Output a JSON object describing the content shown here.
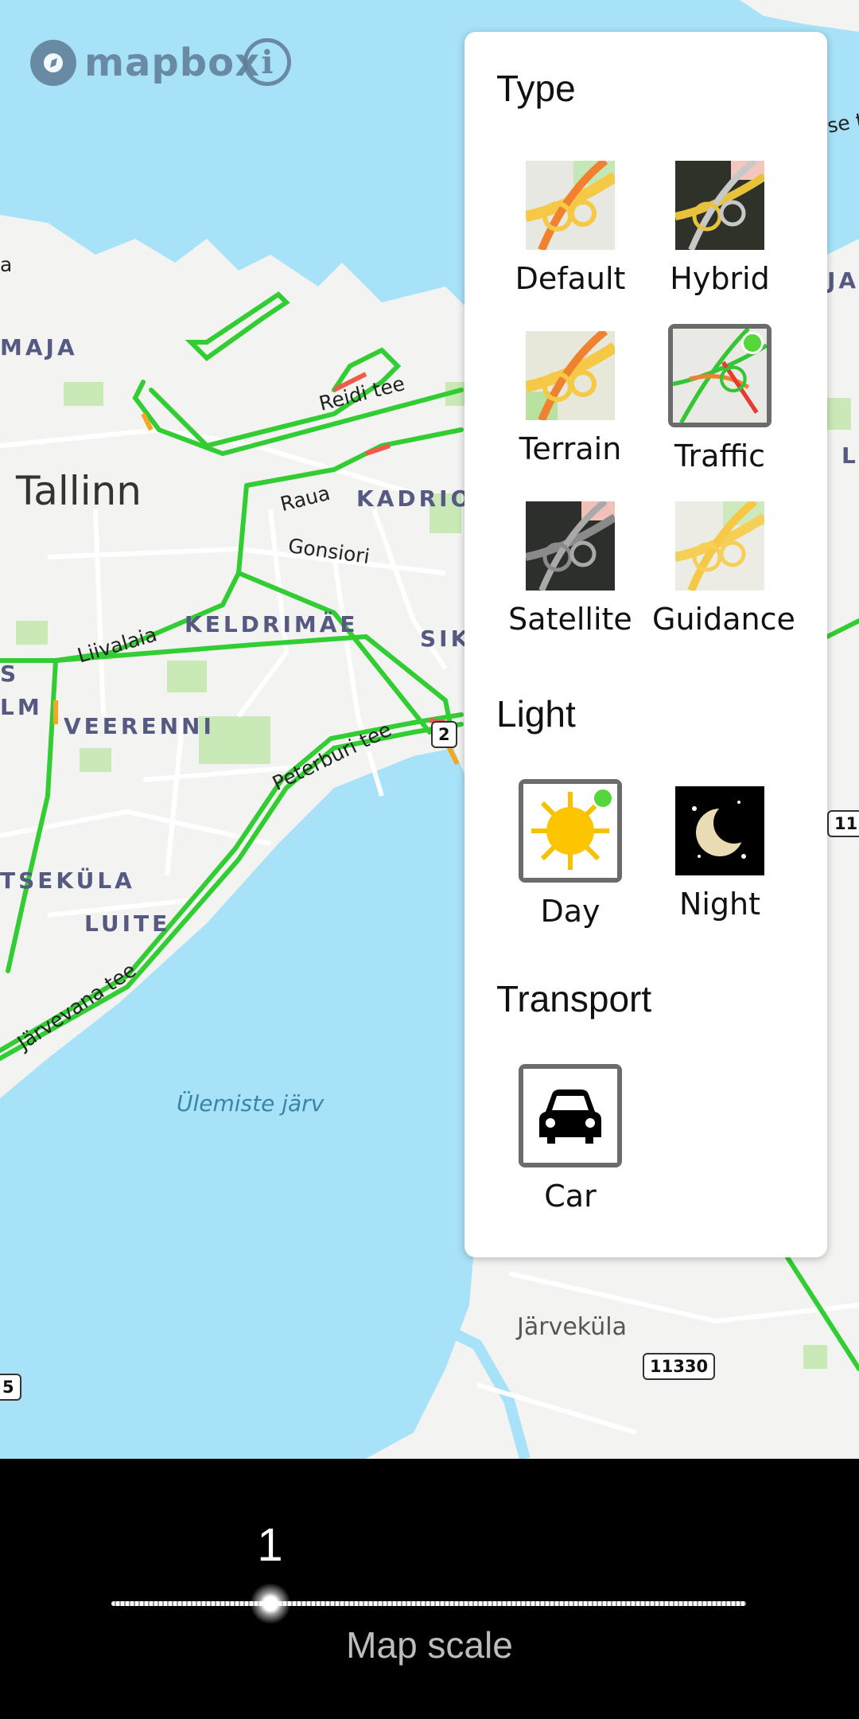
{
  "map": {
    "labels": {
      "city": "Tallinn",
      "maja": "MAJA",
      "kadrio": "KADRIO",
      "keldrimae": "KELDRIMÄE",
      "sik": "SIK",
      "lm": "LM",
      "veerenni": "VEERENNI",
      "tsekula": "TSEKÜLA",
      "luite": "LUITE",
      "ja": "JA",
      "l_right": "L",
      "se": "se t",
      "a_left": "a",
      "s_left": "S",
      "reidi": "Reidi tee",
      "raua": "Raua",
      "gonsiori": "Gonsiori",
      "liivalaia": "Liivalaia",
      "peterburi": "Peterburi tee",
      "jarvevana": "Järvevana tee",
      "lake": "Ülemiste järv",
      "jarvekula": "Järveküla"
    },
    "shields": {
      "r2": "2",
      "r11": "11",
      "r5": "5",
      "r11330": "11330"
    },
    "brand": {
      "name": "mapbox",
      "logo_icon": "mapbox-logo-icon",
      "info_icon": "info-icon"
    }
  },
  "panel": {
    "type_title": "Type",
    "types": [
      {
        "label": "Default",
        "selected": false
      },
      {
        "label": "Hybrid",
        "selected": false
      },
      {
        "label": "Terrain",
        "selected": false
      },
      {
        "label": "Traffic",
        "selected": true
      },
      {
        "label": "Satellite",
        "selected": false
      },
      {
        "label": "Guidance",
        "selected": false
      }
    ],
    "light_title": "Light",
    "lights": [
      {
        "label": "Day",
        "selected": true,
        "icon": "sun-icon"
      },
      {
        "label": "Night",
        "selected": false,
        "icon": "moon-icon"
      }
    ],
    "transport_title": "Transport",
    "transports": [
      {
        "label": "Car",
        "selected": true,
        "icon": "car-icon"
      }
    ]
  },
  "bottom": {
    "scale_value": "1",
    "scale_label": "Map scale",
    "scale_fraction": 0.25
  },
  "colors": {
    "water": "#a8e2f9",
    "traffic_green": "#32cd32",
    "selected_dot": "#55d63a",
    "selected_border": "#6b6b6b",
    "brand": "#5e7c95"
  }
}
